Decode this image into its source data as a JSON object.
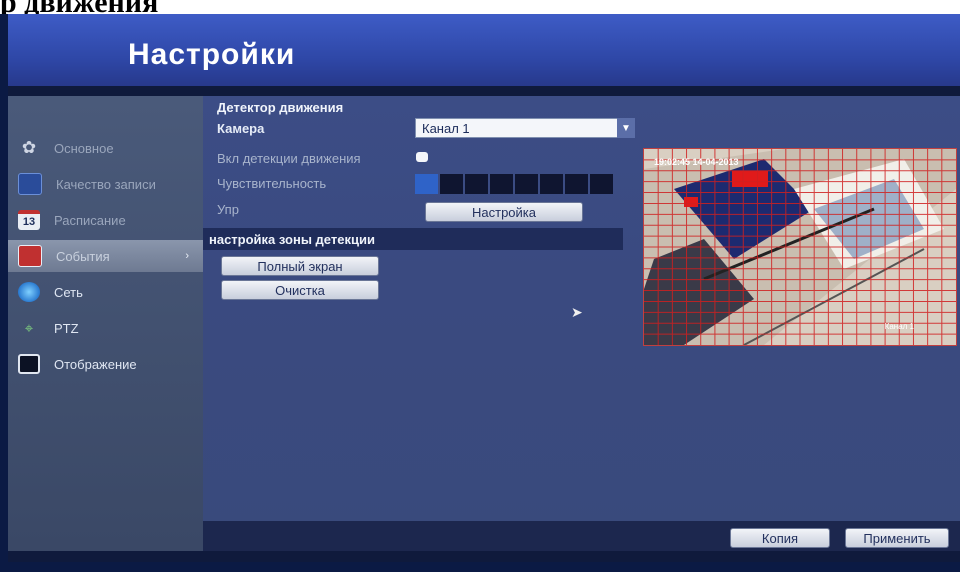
{
  "doc": {
    "heading": "р движения"
  },
  "header": {
    "title": "Настройки"
  },
  "sidebar": {
    "items": [
      {
        "label": "Основное",
        "icon": "gears-icon",
        "state": "muted"
      },
      {
        "label": "Качество записи",
        "icon": "film-icon",
        "state": "muted"
      },
      {
        "label": "Расписание",
        "icon": "calendar-icon",
        "state": "muted",
        "icon_text": "13"
      },
      {
        "label": "События",
        "icon": "event-flag-icon",
        "state": "active",
        "arrow": "›"
      },
      {
        "label": "Сеть",
        "icon": "network-globe-icon",
        "state": "normal"
      },
      {
        "label": "PTZ",
        "icon": "ptz-camera-icon",
        "state": "normal"
      },
      {
        "label": "Отображение",
        "icon": "monitor-icon",
        "state": "normal"
      }
    ]
  },
  "main": {
    "section_title": "Детектор движения",
    "camera_label": "Камера",
    "camera_value": "Канал 1",
    "enable_label": "Вкл детекции движения",
    "enable_checked": false,
    "sensitivity_label": "Чувствительность",
    "sensitivity_level": 1,
    "sensitivity_steps": 8,
    "control_label": "Упр",
    "setup_button": "Настройка",
    "zone_section_title": "настройка зоны детекции",
    "fullscreen_button": "Полный экран",
    "clear_button": "Очистка",
    "preview": {
      "timestamp": "19:02:45 14-04-2013",
      "channel_label": "Канал 1"
    }
  },
  "footer": {
    "copy_button": "Копия",
    "apply_button": "Применить"
  },
  "colors": {
    "header": "#3e5cc6",
    "sidebar": "#4a5a7a",
    "main": "#3c4d86",
    "accent": "#2f63c8",
    "grid": "#d02020"
  }
}
